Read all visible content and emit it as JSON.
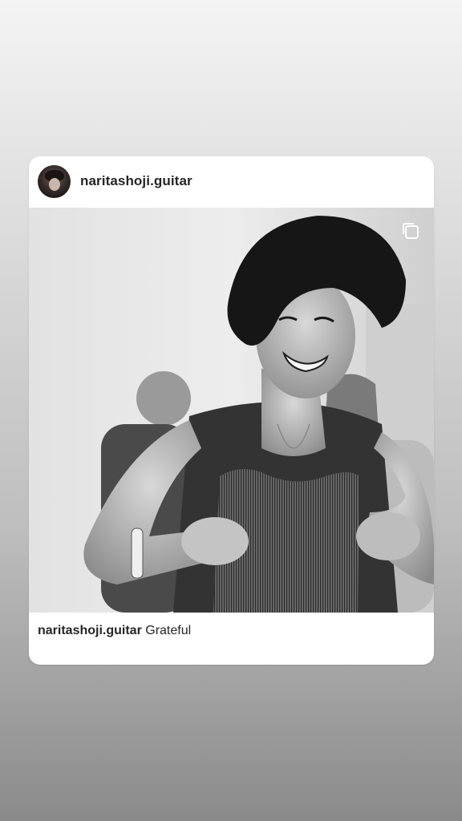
{
  "post": {
    "username": "naritashoji.guitar",
    "caption_user": "naritashoji.guitar",
    "caption_text": "Grateful",
    "avatar": "profile-photo",
    "media": "black-and-white photo of a smiling guitarist with a guitar-shaped apron",
    "media_indicator_icon": "multiple-photos-icon"
  }
}
